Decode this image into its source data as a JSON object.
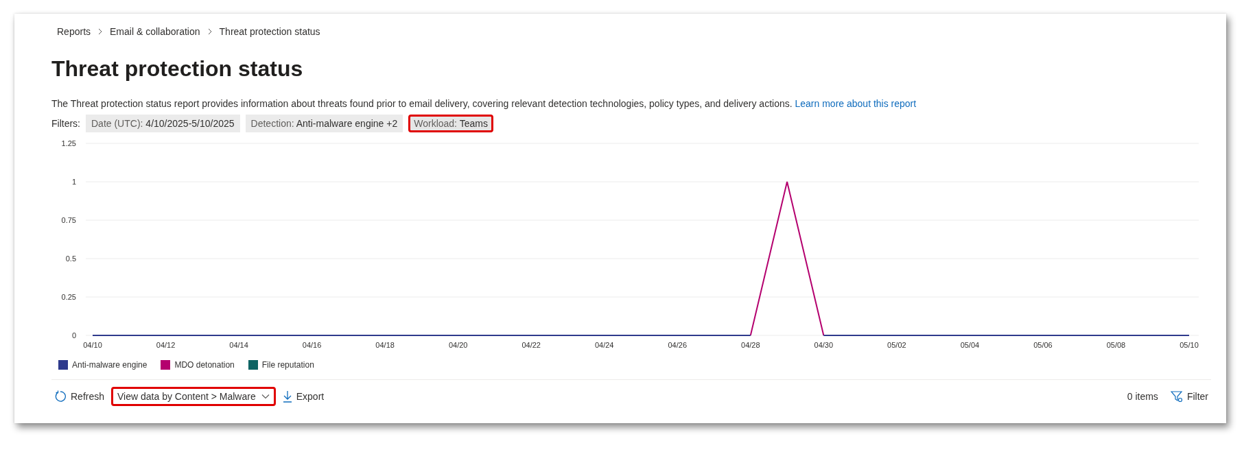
{
  "breadcrumb": [
    "Reports",
    "Email & collaboration",
    "Threat protection status"
  ],
  "title": "Threat protection status",
  "description": "The Threat protection status report provides information about threats found prior to email delivery, covering relevant detection technologies, policy types, and delivery actions.",
  "learn_more_link": "Learn more about this report",
  "filters_label": "Filters:",
  "filters": [
    {
      "label": "Date (UTC):",
      "value": "4/10/2025-5/10/2025",
      "highlighted": false
    },
    {
      "label": "Detection:",
      "value": "Anti-malware engine +2",
      "highlighted": false
    },
    {
      "label": "Workload:",
      "value": "Teams",
      "highlighted": true
    }
  ],
  "chart": {
    "chart_data": {
      "type": "line",
      "grid": true,
      "categories": [
        "04/10",
        null,
        "04/12",
        null,
        "04/14",
        null,
        "04/16",
        null,
        "04/18",
        null,
        "04/20",
        null,
        "04/22",
        null,
        "04/24",
        null,
        "04/26",
        null,
        "04/28",
        null,
        "04/30",
        null,
        "05/02",
        null,
        "05/04",
        null,
        "05/06",
        null,
        "05/08",
        null,
        "05/10"
      ],
      "series": [
        {
          "name": "Anti-malware engine",
          "color": "#2e3a8c",
          "values": [
            0,
            0,
            0,
            0,
            0,
            0,
            0,
            0,
            0,
            0,
            0,
            0,
            0,
            0,
            0,
            0,
            0,
            0,
            0,
            null,
            0,
            0,
            0,
            0,
            0,
            0,
            0,
            0,
            0,
            0,
            0
          ]
        },
        {
          "name": "MDO detonation",
          "color": "#b4006e",
          "values": [
            null,
            null,
            null,
            null,
            null,
            null,
            null,
            null,
            null,
            null,
            null,
            null,
            null,
            null,
            null,
            null,
            null,
            null,
            0,
            1,
            0,
            null,
            null,
            null,
            null,
            null,
            null,
            null,
            null,
            null,
            null
          ]
        },
        {
          "name": "File reputation",
          "color": "#0e6464",
          "values": [
            null,
            null,
            null,
            null,
            null,
            null,
            null,
            null,
            null,
            null,
            null,
            null,
            null,
            null,
            null,
            null,
            null,
            null,
            null,
            null,
            null,
            null,
            null,
            null,
            null,
            null,
            null,
            null,
            null,
            null,
            null
          ]
        }
      ],
      "ylim": [
        0,
        1.25
      ],
      "yticks": [
        0,
        0.25,
        0.5,
        0.75,
        1,
        1.25
      ]
    }
  },
  "toolbar": {
    "refresh": "Refresh",
    "view_dropdown": {
      "label": "View data by Content > Malware",
      "highlighted": true
    },
    "export": "Export",
    "item_count": "0 items",
    "filter": "Filter"
  }
}
